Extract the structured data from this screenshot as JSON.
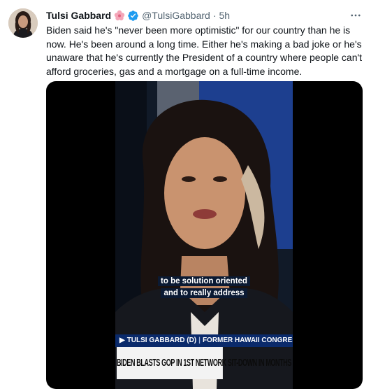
{
  "tweet": {
    "author_name": "Tulsi Gabbard",
    "handle": "@TulsiGabbard",
    "separator": "·",
    "time": "5h",
    "more_icon": "more-horizontal-icon",
    "text": "Biden said he's \"never been more optimistic\" for our country than he is now. He's been around a long time. Either he's making a bad joke or he's unaware that he's currently the President of a country where people can't afford groceries, gas and a mortgage on a full-time income."
  },
  "video": {
    "caption_line1": "to be solution oriented",
    "caption_line2": "and to really address",
    "lower_third_name": "TULSI GABBARD (D)",
    "lower_third_title": "FORMER HAWAII CONGRESSWOMAN",
    "headline": "BIDEN BLASTS GOP IN 1ST NETWORK SIT-DOWN IN MONTHS"
  },
  "colors": {
    "verified": "#1d9bf0",
    "secondary_text": "#536471",
    "chyron_blue": "#0a2a6b"
  }
}
